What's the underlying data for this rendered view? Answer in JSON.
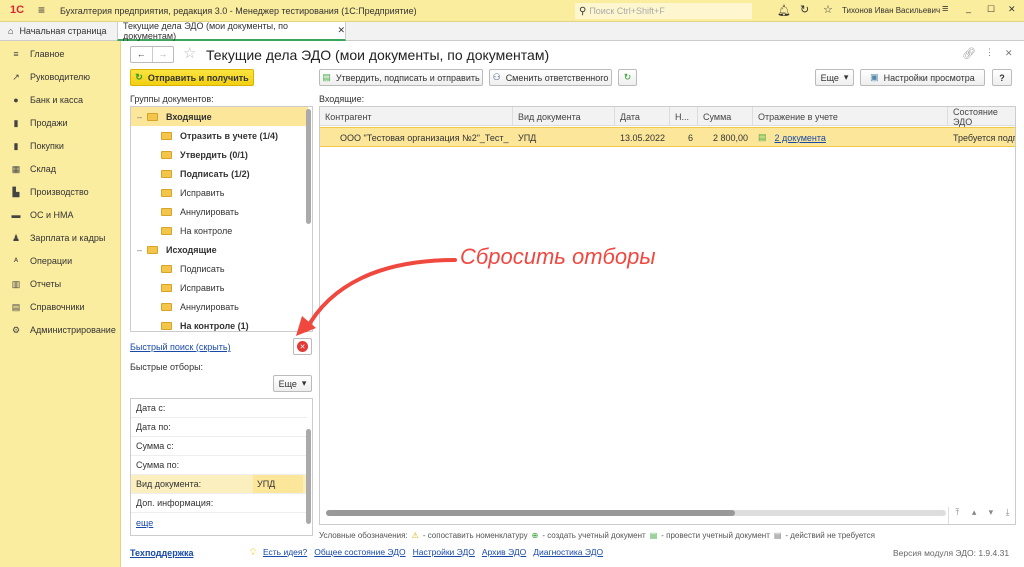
{
  "titlebar": {
    "logo": "1С",
    "title": "Бухгалтерия предприятия, редакция 3.0  - Менеджер тестирования (1С:Предприятие)",
    "search_placeholder": "Поиск Ctrl+Shift+F",
    "user": "Тихонов Иван Васильевич"
  },
  "tabs": {
    "home": "Начальная страница",
    "active": "Текущие дела ЭДО (мои документы, по документам)"
  },
  "sidebar": {
    "items": [
      {
        "label": "Главное",
        "icon": "≡"
      },
      {
        "label": "Руководителю",
        "icon": "↗"
      },
      {
        "label": "Банк и касса",
        "icon": "●"
      },
      {
        "label": "Продажи",
        "icon": "▮"
      },
      {
        "label": "Покупки",
        "icon": "▮"
      },
      {
        "label": "Склад",
        "icon": "▦"
      },
      {
        "label": "Производство",
        "icon": "▙"
      },
      {
        "label": "ОС и НМА",
        "icon": "▬"
      },
      {
        "label": "Зарплата и кадры",
        "icon": "♟"
      },
      {
        "label": "Операции",
        "icon": "ᴬ"
      },
      {
        "label": "Отчеты",
        "icon": "▥"
      },
      {
        "label": "Справочники",
        "icon": "▤"
      },
      {
        "label": "Администрирование",
        "icon": "⚙"
      }
    ]
  },
  "page": {
    "title": "Текущие дела ЭДО (мои документы, по документам)"
  },
  "toolbar": {
    "send_receive": "Отправить и получить",
    "approve_sign_send": "Утвердить, подписать и отправить",
    "change_responsible": "Сменить ответственного",
    "more": "Еще",
    "view_settings": "Настройки просмотра",
    "help": "?"
  },
  "groups": {
    "label": "Группы документов:",
    "items": [
      {
        "label": "Входящие",
        "level": 0,
        "bold": true
      },
      {
        "label": "Отразить в учете (1/4)",
        "level": 1,
        "bold": true
      },
      {
        "label": "Утвердить (0/1)",
        "level": 1,
        "bold": true
      },
      {
        "label": "Подписать (1/2)",
        "level": 1,
        "bold": true
      },
      {
        "label": "Исправить",
        "level": 1,
        "bold": false
      },
      {
        "label": "Аннулировать",
        "level": 1,
        "bold": false
      },
      {
        "label": "На контроле",
        "level": 1,
        "bold": false
      },
      {
        "label": "Исходящие",
        "level": 0,
        "bold": true
      },
      {
        "label": "Подписать",
        "level": 1,
        "bold": false
      },
      {
        "label": "Исправить",
        "level": 1,
        "bold": false
      },
      {
        "label": "Аннулировать",
        "level": 1,
        "bold": false
      },
      {
        "label": "На контроле (1)",
        "level": 1,
        "bold": true
      }
    ]
  },
  "quick_search": {
    "link": "Быстрый поиск (скрыть)"
  },
  "quick_filters": {
    "label": "Быстрые отборы:",
    "more": "Еще",
    "rows": [
      {
        "label": "Дата с:",
        "value": ""
      },
      {
        "label": "Дата по:",
        "value": ""
      },
      {
        "label": "Сумма с:",
        "value": ""
      },
      {
        "label": "Сумма по:",
        "value": ""
      },
      {
        "label": "Вид документа:",
        "value": "УПД"
      },
      {
        "label": "Доп. информация:",
        "value": ""
      }
    ],
    "more_link": "еще"
  },
  "table": {
    "label": "Входящие:",
    "columns": [
      "Контрагент",
      "Вид документа",
      "Дата",
      "Н...",
      "Сумма",
      "Отражение в учете",
      "Состояние ЭДО"
    ],
    "rows": [
      {
        "counterparty": "ООО \"Тестовая организация №2\"_Тест_",
        "doc_type": "УПД",
        "date": "13.05.2022",
        "n": "6",
        "sum": "2 800,00",
        "reflection": "2 документа",
        "state": "Требуется подпись"
      }
    ]
  },
  "legend": {
    "label": "Условные обозначения:",
    "items": [
      "- сопоставить номенклатуру",
      "- создать учетный документ",
      "- провести учетный документ",
      "- действий не требуется"
    ]
  },
  "footer": {
    "support": "Техподдержка",
    "idea": "Есть идея?",
    "links": [
      "Общее состояние ЭДО",
      "Настройки ЭДО",
      "Архив ЭДО",
      "Диагностика ЭДО"
    ],
    "version": "Версия модуля ЭДО: 1.9.4.31"
  },
  "annotation": {
    "text": "Сбросить отборы"
  },
  "colors": {
    "accent": "#fbed9e",
    "button_yellow": "#f7d924",
    "annotation": "#f0473f",
    "selected_row": "#fbe69a"
  }
}
